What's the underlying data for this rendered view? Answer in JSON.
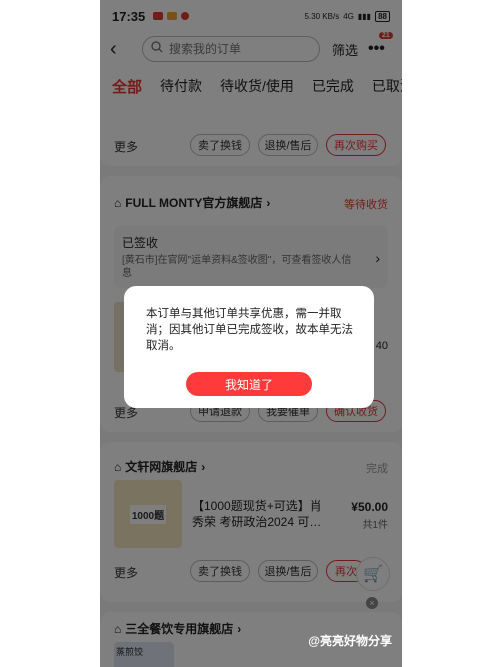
{
  "status_bar": {
    "time": "17:35",
    "network": "5.30 KB/s",
    "signal": "4G",
    "battery": "88"
  },
  "top_bar": {
    "search_placeholder": "搜索我的订单",
    "filter_label": "筛选",
    "badge_count": "21"
  },
  "tabs": [
    "全部",
    "待付款",
    "待收货/使用",
    "已完成",
    "已取消"
  ],
  "order1": {
    "more": "更多",
    "btn1": "卖了换钱",
    "btn2": "退换/售后",
    "btn3": "再次购买"
  },
  "order2": {
    "store": "FULL MONTY官方旗舰店",
    "status": "等待收货",
    "logistics_title": "已签收",
    "logistics_text": "[黄石市]在官网\"运单资料&签收图\"，可查看签收人信息",
    "price_fragment": "40",
    "more": "更多",
    "btn1": "申请退款",
    "btn2": "我要催单",
    "btn3": "确认收货"
  },
  "order3": {
    "store": "文轩网旗舰店",
    "status": "完成",
    "thumb_text": "1000题",
    "title": "【1000题现货+可选】肖秀荣 考研政治2024 可…",
    "price": "¥50.00",
    "qty": "共1件",
    "more": "更多",
    "btn1": "卖了换钱",
    "btn2": "退换/售后",
    "btn3": "再次"
  },
  "order4": {
    "store": "三全餐饮专用旗舰店",
    "thumb_text": "蒸煎饺"
  },
  "dialog": {
    "message": "本订单与其他订单共享优惠，需一并取消；因其他订单已完成签收，故本单无法取消。",
    "ok_label": "我知道了"
  },
  "watermark": "@亮亮好物分享",
  "colors": {
    "accent": "#e53935",
    "dialog_button": "#ff3a3a"
  }
}
